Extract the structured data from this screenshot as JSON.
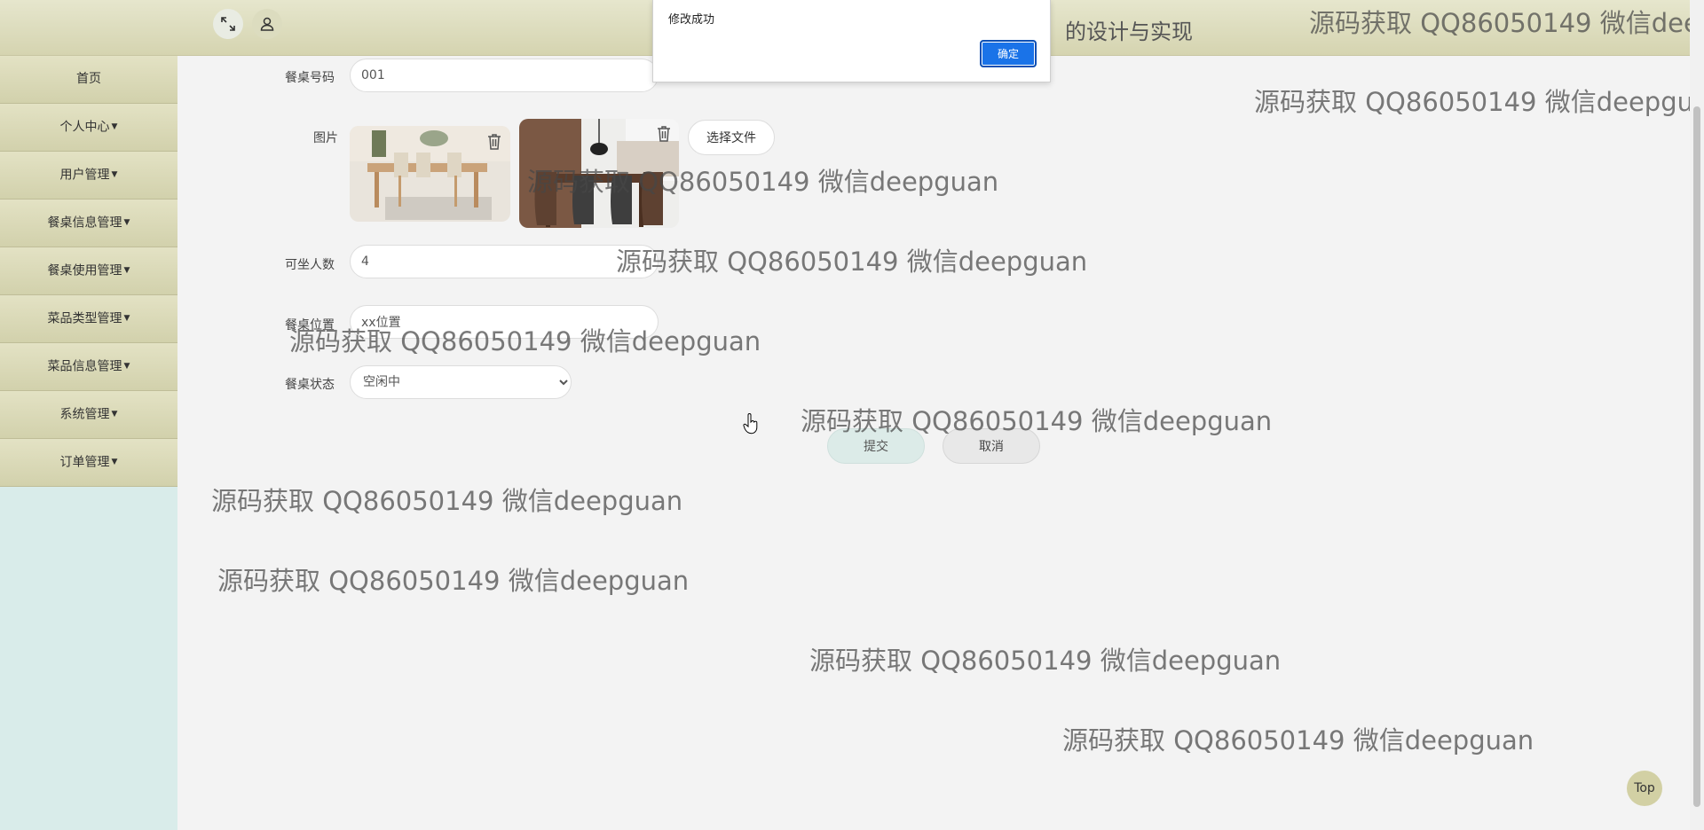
{
  "sidebar": {
    "items": [
      {
        "label": "首页",
        "has_caret": false
      },
      {
        "label": "个人中心",
        "has_caret": true
      },
      {
        "label": "用户管理",
        "has_caret": true
      },
      {
        "label": "餐桌信息管理",
        "has_caret": true
      },
      {
        "label": "餐桌使用管理",
        "has_caret": true
      },
      {
        "label": "菜品类型管理",
        "has_caret": true
      },
      {
        "label": "菜品信息管理",
        "has_caret": true
      },
      {
        "label": "系统管理",
        "has_caret": true
      },
      {
        "label": "订单管理",
        "has_caret": true
      }
    ]
  },
  "header": {
    "title_fragment": "的设计与实现",
    "icons": [
      "fullscreen-icon",
      "user-icon"
    ]
  },
  "form": {
    "table_number": {
      "label": "餐桌号码",
      "value": "001"
    },
    "images": {
      "label": "图片",
      "choose_label": "选择文件"
    },
    "capacity": {
      "label": "可坐人数",
      "value": "4"
    },
    "location": {
      "label": "餐桌位置",
      "value": "xx位置"
    },
    "status": {
      "label": "餐桌状态",
      "selected": "空闲中"
    },
    "submit_label": "提交",
    "cancel_label": "取消"
  },
  "alert": {
    "message": "修改成功",
    "ok_label": "确定"
  },
  "watermark": "源码获取 QQ86050149 微信deepguan",
  "top_button": "Top",
  "colors": {
    "sidebar_bg": "#d9ecea",
    "menu_bg": "#d8d7b5",
    "accent_blue": "#1a73e8"
  }
}
